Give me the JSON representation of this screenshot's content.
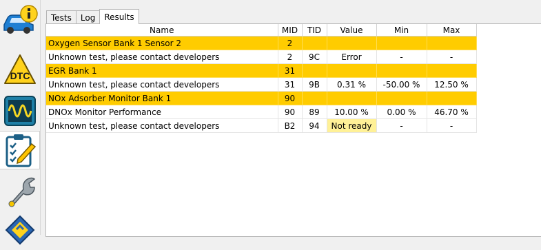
{
  "sidebar": {
    "items": [
      {
        "icon": "car-info-icon"
      },
      {
        "icon": "dtc-icon",
        "label": "DTC"
      },
      {
        "icon": "oscilloscope-icon"
      },
      {
        "icon": "checklist-icon"
      },
      {
        "icon": "wrench-icon"
      },
      {
        "icon": "chip-icon"
      }
    ]
  },
  "tabs": [
    {
      "label": "Tests"
    },
    {
      "label": "Log"
    },
    {
      "label": "Results",
      "active": true
    }
  ],
  "table": {
    "columns": [
      "Name",
      "MID",
      "TID",
      "Value",
      "Min",
      "Max"
    ],
    "rows": [
      {
        "name": "Oxygen Sensor Bank 1 Sensor 2",
        "mid": "2",
        "tid": "",
        "value": "",
        "min": "",
        "max": "",
        "group": true
      },
      {
        "name": "Unknown test, please contact developers",
        "mid": "2",
        "tid": "9C",
        "value": "Error",
        "min": "-",
        "max": "-"
      },
      {
        "name": "EGR Bank 1",
        "mid": "31",
        "tid": "",
        "value": "",
        "min": "",
        "max": "",
        "group": true
      },
      {
        "name": "Unknown test, please contact developers",
        "mid": "31",
        "tid": "9B",
        "value": "0.31 %",
        "min": "-50.00 %",
        "max": "12.50 %"
      },
      {
        "name": "NOx Adsorber Monitor Bank 1",
        "mid": "90",
        "tid": "",
        "value": "",
        "min": "",
        "max": "",
        "group": true
      },
      {
        "name": "DNOx Monitor Performance",
        "mid": "90",
        "tid": "89",
        "value": "10.00 %",
        "min": "0.00 %",
        "max": "46.70 %"
      },
      {
        "name": "Unknown test, please contact developers",
        "mid": "B2",
        "tid": "94",
        "value": "Not ready",
        "min": "-",
        "max": "-",
        "not_ready": true
      }
    ]
  },
  "colors": {
    "group_row": "#ffcc00",
    "not_ready": "#fff197"
  }
}
